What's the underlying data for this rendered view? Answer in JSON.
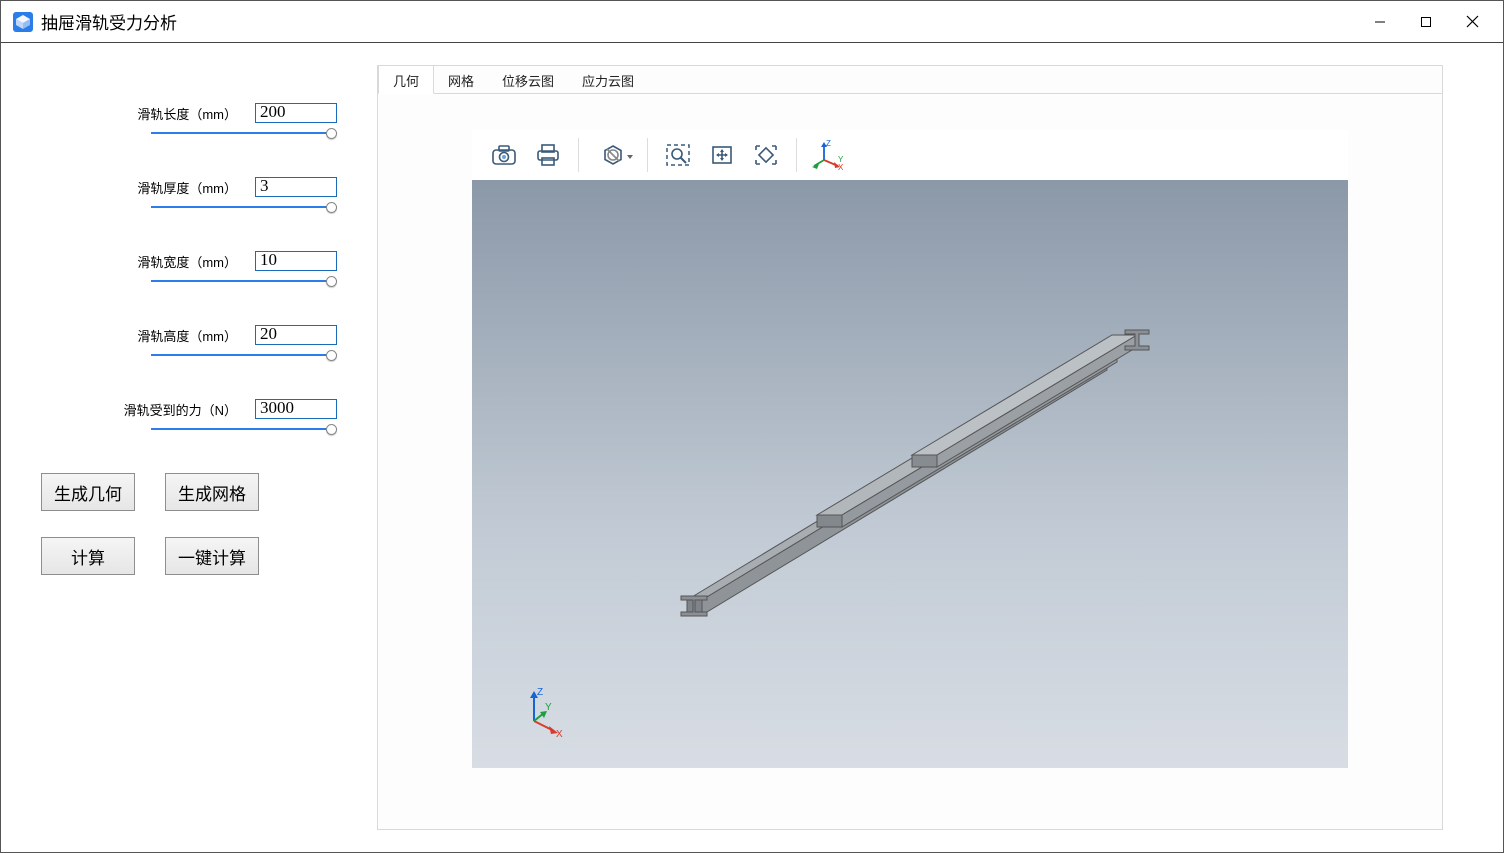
{
  "window": {
    "title": "抽屉滑轨受力分析"
  },
  "params": [
    {
      "label": "滑轨长度（mm）",
      "value": "200"
    },
    {
      "label": "滑轨厚度（mm）",
      "value": "3"
    },
    {
      "label": "滑轨宽度（mm）",
      "value": "10"
    },
    {
      "label": "滑轨高度（mm）",
      "value": "20"
    },
    {
      "label": "滑轨受到的力（N）",
      "value": "3000"
    }
  ],
  "buttons": {
    "gen_geometry": "生成几何",
    "gen_mesh": "生成网格",
    "calc": "计算",
    "one_click_calc": "一键计算"
  },
  "tabs": {
    "geometry": "几何",
    "mesh": "网格",
    "displacement": "位移云图",
    "stress": "应力云图",
    "active": "geometry"
  },
  "axes": {
    "x": "X",
    "y": "Y",
    "z": "Z"
  }
}
